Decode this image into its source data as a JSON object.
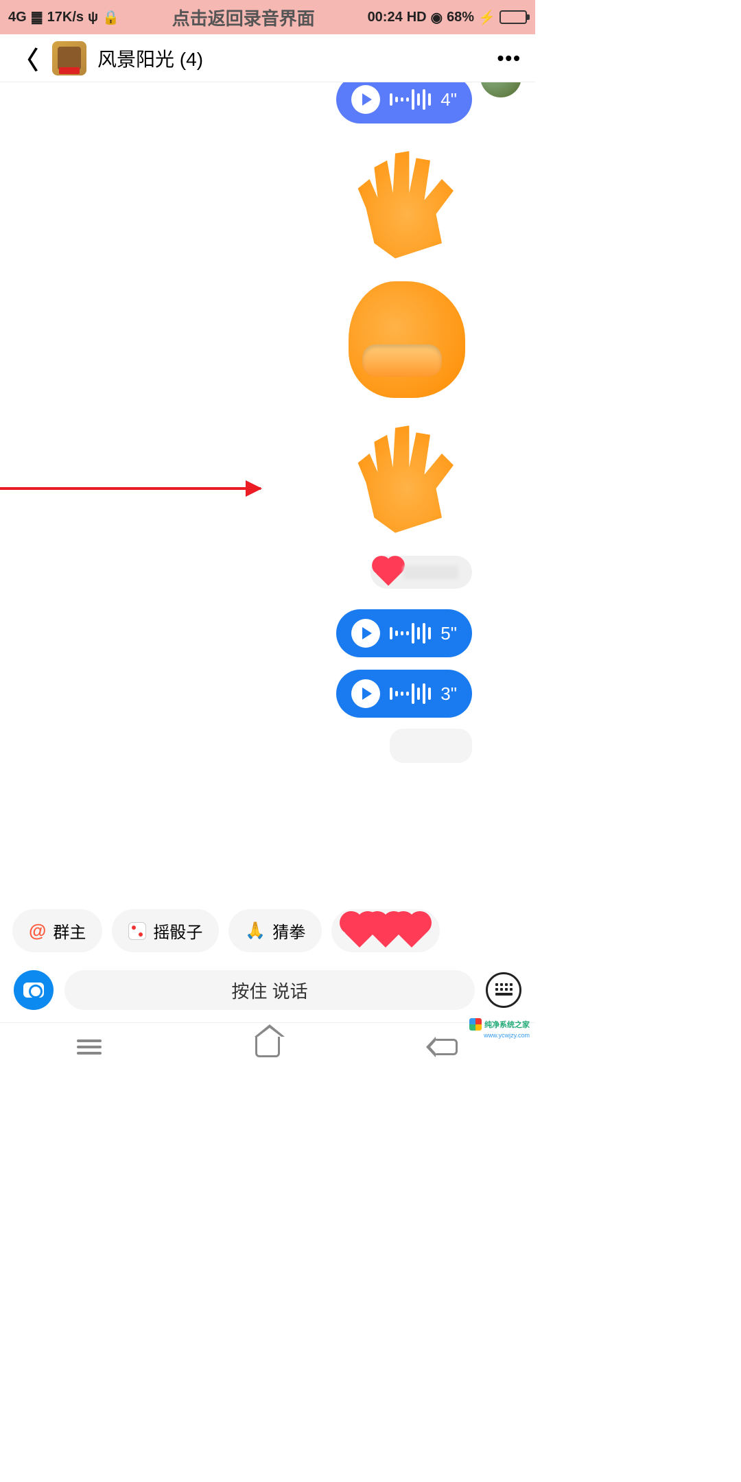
{
  "status": {
    "network": "4G",
    "speed": "17K/s",
    "overlay_text": "点击返回录音界面",
    "time": "00:24",
    "hd": "HD",
    "battery_pct": "68%"
  },
  "header": {
    "title": "风景阳光 (4)"
  },
  "messages": {
    "voice1_dur": "4\"",
    "voice2_dur": "5\"",
    "voice3_dur": "3\""
  },
  "quick": {
    "at_label": "群主",
    "dice_label": "摇骰子",
    "guess_label": "猜拳"
  },
  "input": {
    "hold_to_talk": "按住 说话"
  },
  "watermark": {
    "name": "纯净系统之家",
    "url": "www.ycwjzy.com"
  }
}
